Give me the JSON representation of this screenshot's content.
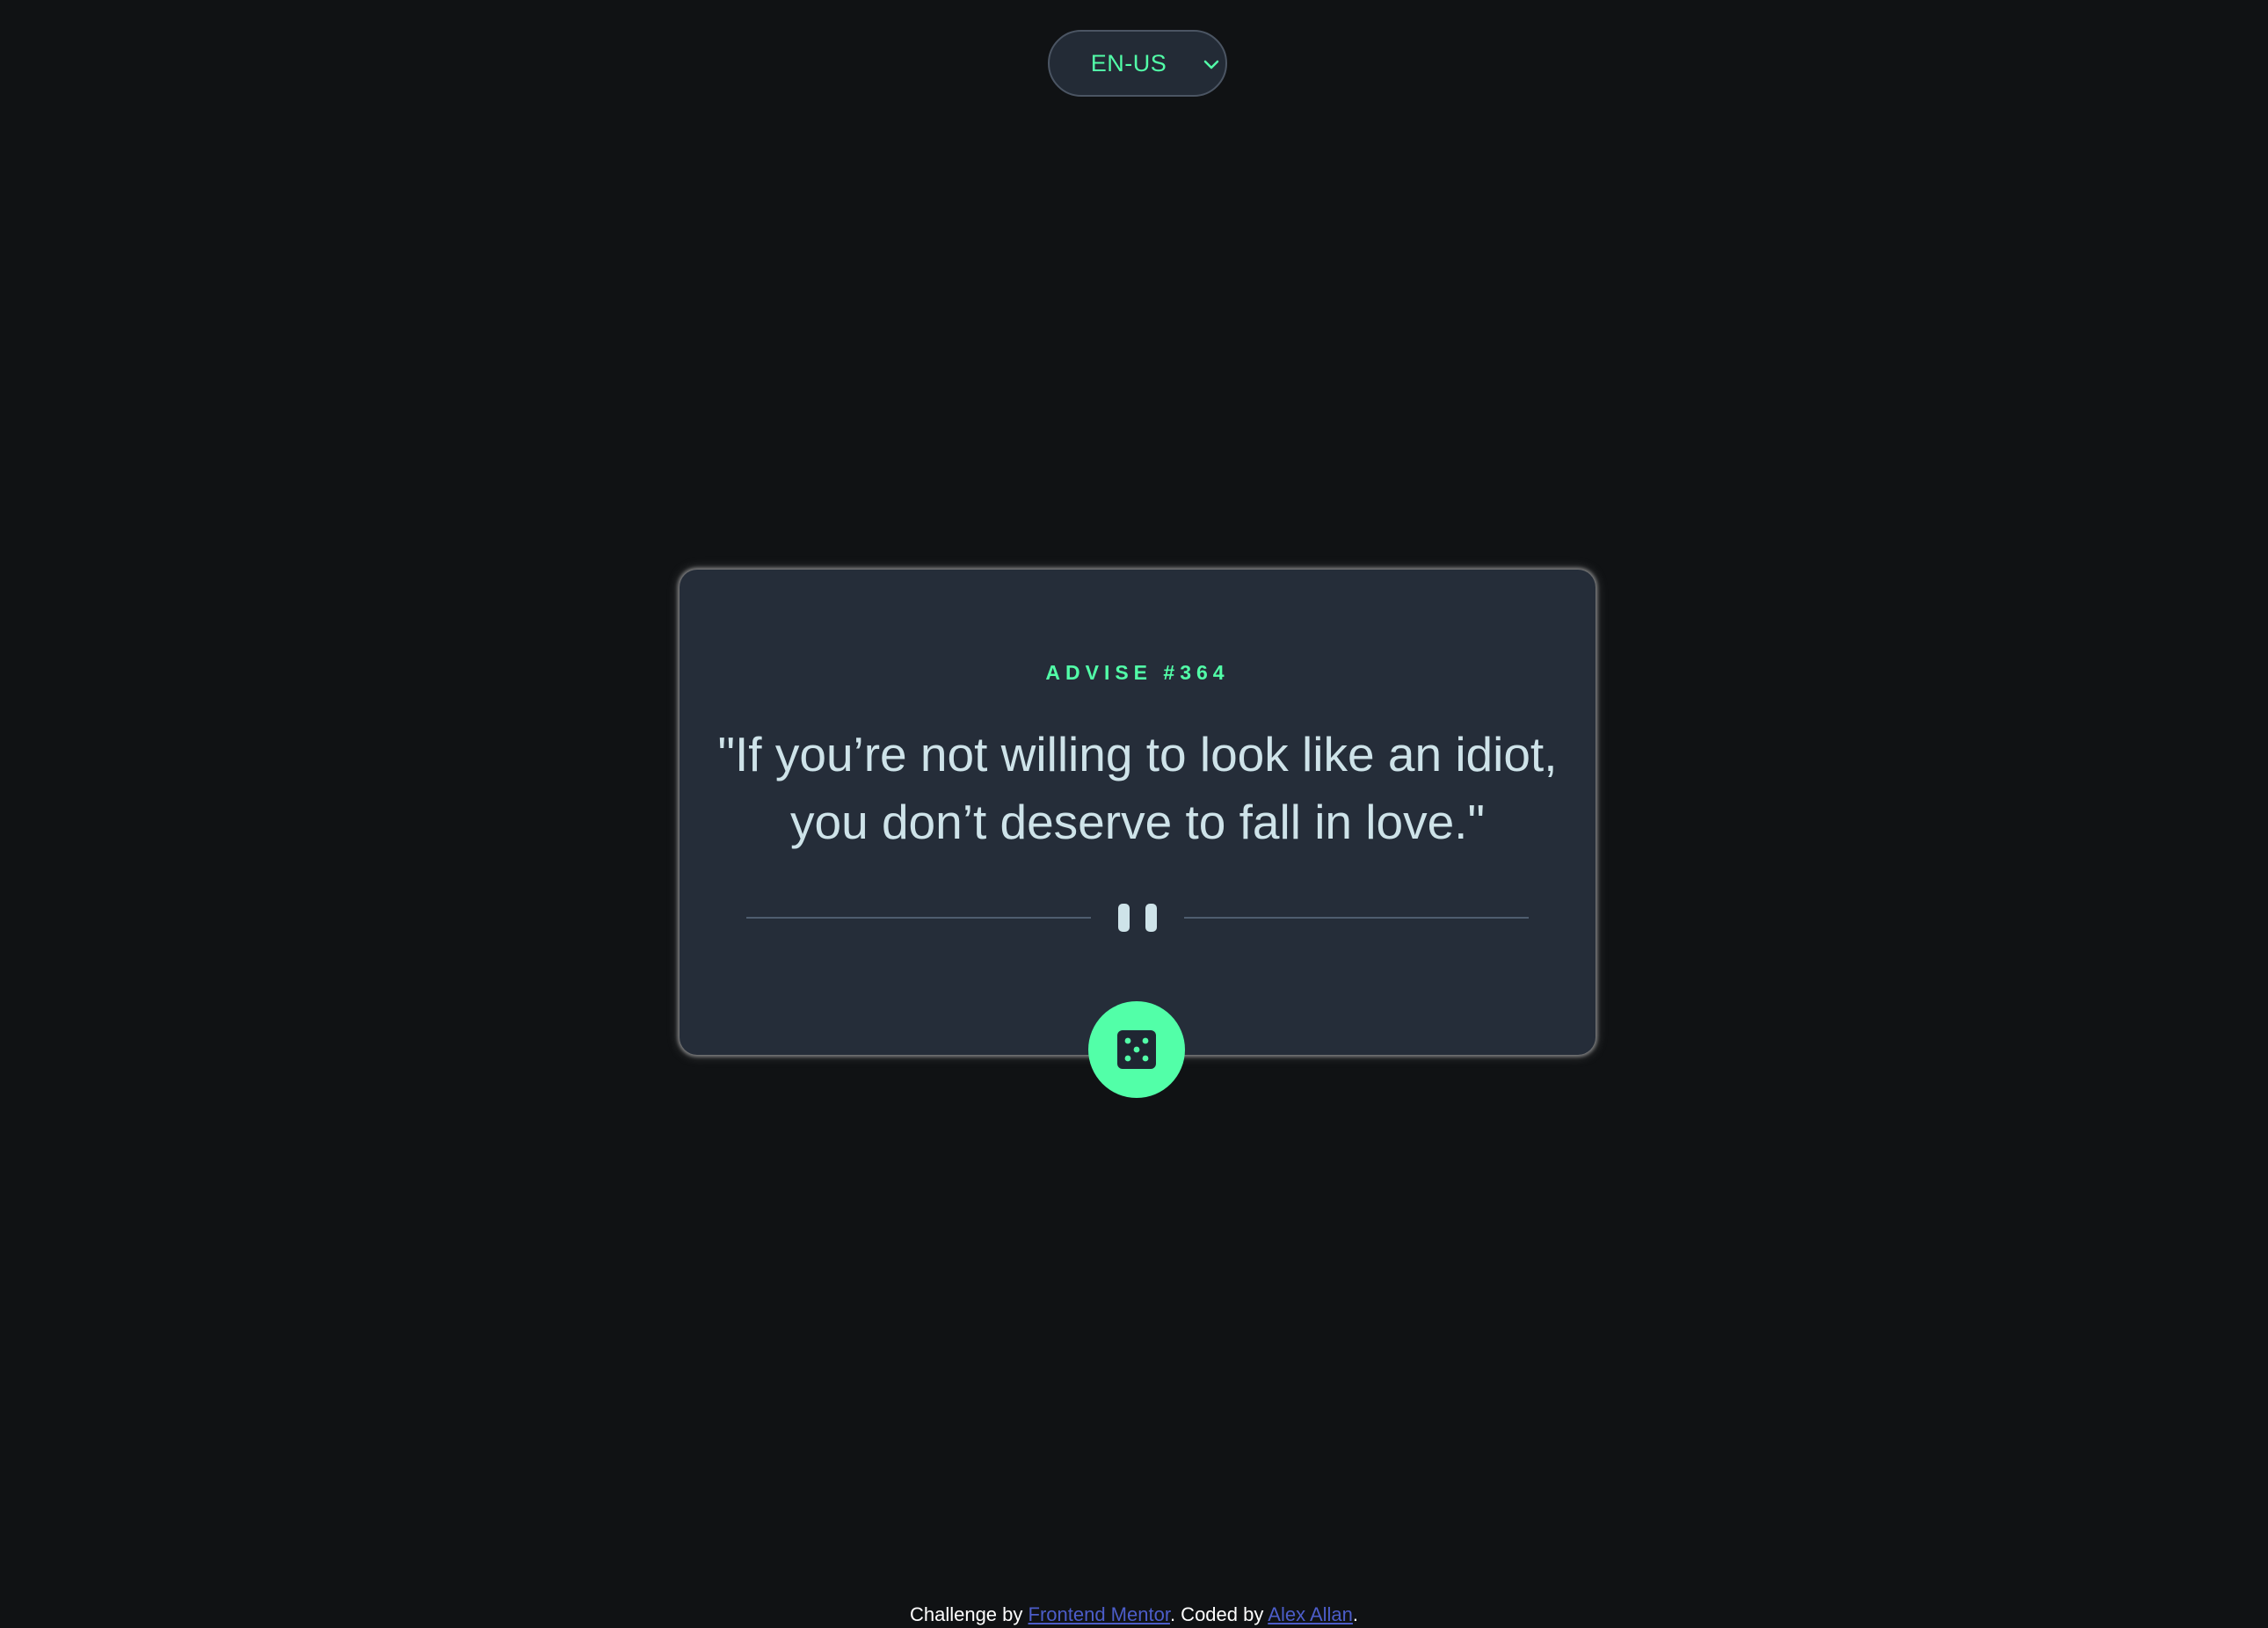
{
  "language": {
    "selected": "EN-US"
  },
  "card": {
    "advice_id": "ADVISE #364",
    "advice_text": "\"If you’re not willing to look like an idiot, you don’t deserve to fall in love.\""
  },
  "footer": {
    "prefix": "Challenge by ",
    "challenge_link": "Frontend Mentor",
    "middle": ". Coded by ",
    "author_link": "Alex Allan",
    "suffix": "."
  },
  "colors": {
    "background": "#101214",
    "card": "#252d39",
    "accent": "#52ffa8",
    "text": "#cee3e9",
    "link": "#4c5dc9"
  },
  "icons": {
    "select": "chevron-down-icon",
    "divider": "pause-icon",
    "button": "dice-icon"
  }
}
